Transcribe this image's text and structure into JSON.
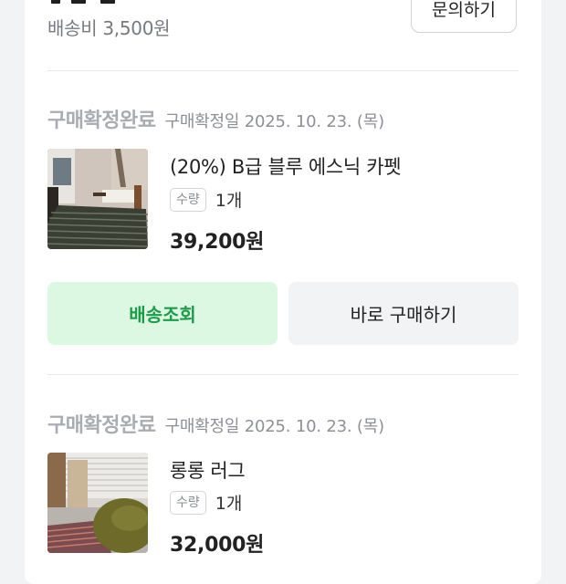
{
  "header": {
    "shipping_fee": "배송비 3,500원",
    "inquiry_label": "문의하기"
  },
  "orders": [
    {
      "status": "구매확정완료",
      "confirm_date": "구매확정일 2025. 10. 23. (목)",
      "product_name": "(20%) B급 블루 에스닉 카펫",
      "qty_label": "수량",
      "qty_value": "1개",
      "price": "39,200원",
      "track_label": "배송조회",
      "buy_label": "바로 구매하기"
    },
    {
      "status": "구매확정완료",
      "confirm_date": "구매확정일 2025. 10. 23. (목)",
      "product_name": "롱롱 러그",
      "qty_label": "수량",
      "qty_value": "1개",
      "price": "32,000원"
    }
  ],
  "colors": {
    "accent_green": "#1c9b48",
    "accent_green_bg": "#dcf8e3",
    "status_gray": "#a9acb1"
  }
}
